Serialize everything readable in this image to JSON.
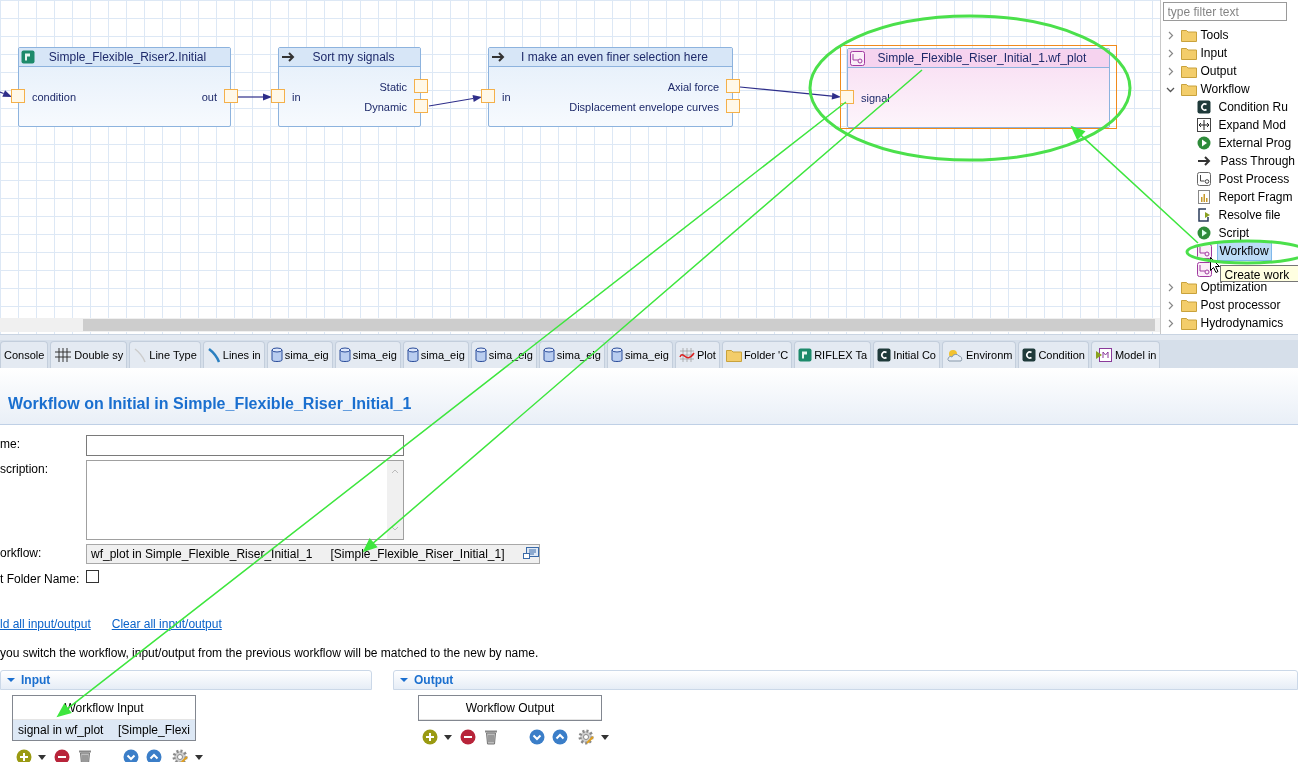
{
  "canvas": {
    "nodes": [
      {
        "kind": "riflex",
        "title": "Simple_Flexible_Riser2.Initial",
        "selected": false,
        "inputs": [
          "condition"
        ],
        "outputs": [
          "out"
        ]
      },
      {
        "kind": "passthrough",
        "title": "Sort my signals",
        "selected": false,
        "inputs": [
          "in"
        ],
        "outputs": [
          "Static",
          "Dynamic"
        ]
      },
      {
        "kind": "passthrough",
        "title": "I make an even finer selection here",
        "selected": false,
        "inputs": [
          "in"
        ],
        "outputs": [
          "Axial force",
          "Displacement envelope curves"
        ]
      },
      {
        "kind": "workflow",
        "title": "Simple_Flexible_Riser_Initial_1.wf_plot",
        "selected": true,
        "inputs": [
          "signal"
        ]
      }
    ]
  },
  "palette": {
    "filter": {
      "placeholder": "type filter text"
    },
    "items": [
      {
        "label": "Tools",
        "expanded": false
      },
      {
        "label": "Input",
        "expanded": false
      },
      {
        "label": "Output",
        "expanded": false
      },
      {
        "label": "Workflow",
        "expanded": true,
        "children": [
          {
            "label": "Condition Ru",
            "kind": "condition",
            "selected": false
          },
          {
            "label": "Expand Mod",
            "kind": "expand",
            "selected": false
          },
          {
            "label": "External Prog",
            "kind": "external",
            "selected": false
          },
          {
            "label": "Pass Through",
            "kind": "passthrough",
            "selected": false
          },
          {
            "label": "Post Process",
            "kind": "postprocessor",
            "selected": false
          },
          {
            "label": "Report Fragm",
            "kind": "report",
            "selected": false
          },
          {
            "label": "Resolve file",
            "kind": "resolve",
            "selected": false
          },
          {
            "label": "Script",
            "kind": "script",
            "selected": false
          },
          {
            "label": "Workflow",
            "kind": "workflow",
            "selected": true
          },
          {
            "kind": "workflow"
          }
        ]
      },
      {
        "label": "Optimization",
        "expanded": false
      },
      {
        "label": "Post processor",
        "expanded": false
      },
      {
        "label": "Hydrodynamics",
        "expanded": false
      }
    ],
    "tooltip": "Create work"
  },
  "tabs": [
    {
      "label": "Console",
      "kind": "none"
    },
    {
      "label": "Double sy",
      "kind": "doublesy"
    },
    {
      "label": "Line Type",
      "kind": "linetype"
    },
    {
      "label": "Lines in",
      "kind": "lines"
    },
    {
      "label": "sima_eig",
      "kind": "db"
    },
    {
      "label": "sima_eig",
      "kind": "db"
    },
    {
      "label": "sima_eig",
      "kind": "db"
    },
    {
      "label": "sima_eig",
      "kind": "db"
    },
    {
      "label": "sima_eig",
      "kind": "db"
    },
    {
      "label": "sima_eig",
      "kind": "db"
    },
    {
      "label": "Plot",
      "kind": "plot"
    },
    {
      "label": "Folder 'C",
      "kind": "folder"
    },
    {
      "label": "RIFLEX Ta",
      "kind": "riflex"
    },
    {
      "label": "Initial Co",
      "kind": "condition"
    },
    {
      "label": "Environm",
      "kind": "environment"
    },
    {
      "label": "Condition",
      "kind": "condition"
    },
    {
      "label": "Model in",
      "kind": "model"
    }
  ],
  "form": {
    "title": "Workflow on Initial in Simple_Flexible_Riser_Initial_1",
    "fields": [
      {
        "kind": "text",
        "label": "me:"
      },
      {
        "kind": "textarea",
        "label": "scription:"
      },
      {
        "kind": "reference",
        "label": "orkflow:",
        "value": "wf_plot in Simple_Flexible_Riser_Initial_1",
        "location": "[Simple_Flexible_Riser_Initial_1]"
      },
      {
        "kind": "checkbox",
        "label": "t Folder Name:",
        "checked": false
      }
    ],
    "links": [
      "ld all input/output",
      "Clear all input/output"
    ],
    "note": "you switch the workflow, input/output from the previous workflow will be matched to the new by name.",
    "sections": [
      {
        "title": "Input",
        "expanded": true,
        "table": {
          "header": "Workflow Input",
          "rows": [
            [
              "signal in wf_plot",
              "[Simple_Flexi"
            ]
          ]
        }
      },
      {
        "title": "Output",
        "expanded": true,
        "table": {
          "header": "Workflow Output"
        }
      }
    ]
  }
}
